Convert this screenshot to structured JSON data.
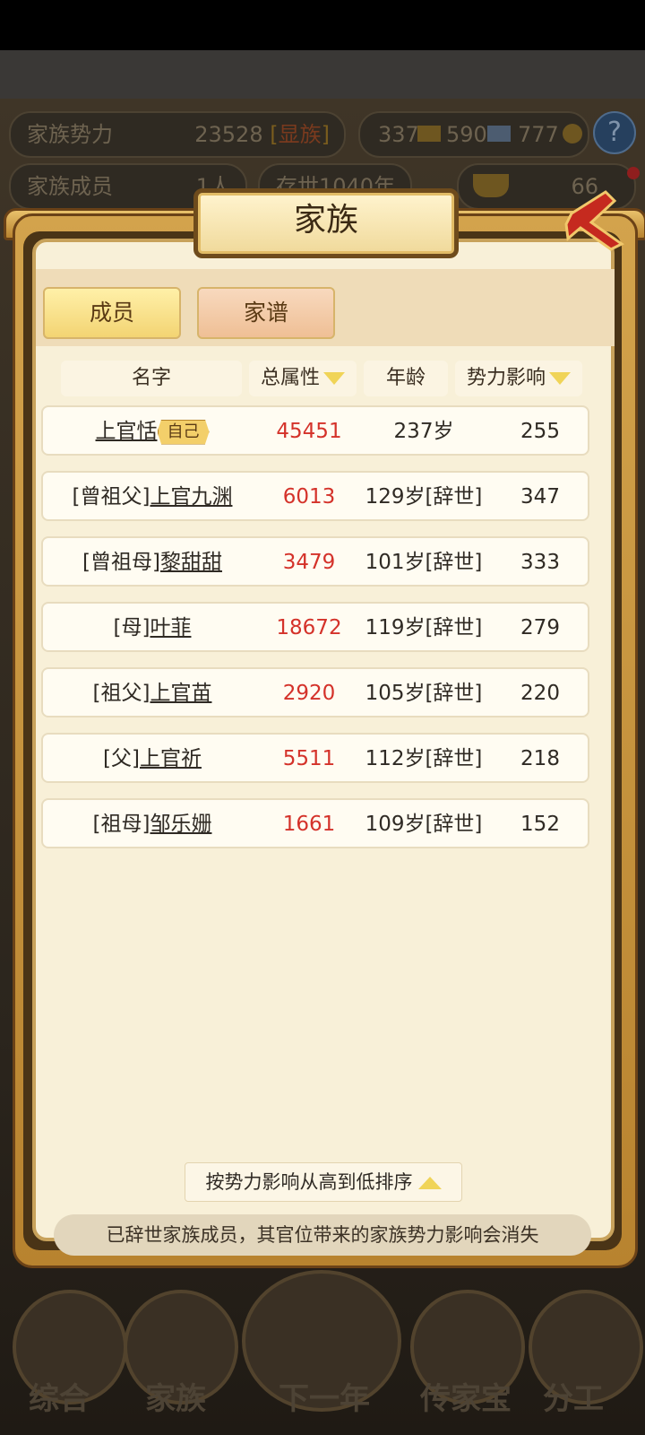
{
  "background_hud": {
    "influence_label": "家族势力",
    "influence_value": "23528",
    "rank_prefix": "[",
    "rank_tag": "显族",
    "rank_suffix": "]",
    "gold_bars": "337",
    "silver_bars": "590",
    "coins": "777",
    "help_label": "?",
    "members_label": "家族成员",
    "members_value": "1人",
    "existence": "存世1040年",
    "ingots": "66"
  },
  "modal": {
    "title": "家族",
    "tabs": [
      {
        "label": "成员",
        "active": true
      },
      {
        "label": "家谱",
        "active": false
      }
    ],
    "columns": {
      "name": "名字",
      "total_attr": "总属性",
      "age": "年龄",
      "influence": "势力影响"
    },
    "self_badge": "自己",
    "rows": [
      {
        "prefix": "",
        "name": "上官恬",
        "is_self": true,
        "total_attr": "45451",
        "age": "237岁",
        "influence": "255"
      },
      {
        "prefix": "[曾祖父]",
        "name": "上官九渊",
        "is_self": false,
        "total_attr": "6013",
        "age": "129岁[辞世]",
        "influence": "347"
      },
      {
        "prefix": "[曾祖母]",
        "name": "黎甜甜",
        "is_self": false,
        "total_attr": "3479",
        "age": "101岁[辞世]",
        "influence": "333"
      },
      {
        "prefix": "[母]",
        "name": "叶菲",
        "is_self": false,
        "total_attr": "18672",
        "age": "119岁[辞世]",
        "influence": "279"
      },
      {
        "prefix": "[祖父]",
        "name": "上官苗",
        "is_self": false,
        "total_attr": "2920",
        "age": "105岁[辞世]",
        "influence": "220"
      },
      {
        "prefix": "[父]",
        "name": "上官祈",
        "is_self": false,
        "total_attr": "5511",
        "age": "112岁[辞世]",
        "influence": "218"
      },
      {
        "prefix": "[祖母]",
        "name": "邹乐姗",
        "is_self": false,
        "total_attr": "1661",
        "age": "109岁[辞世]",
        "influence": "152"
      }
    ],
    "sort_label": "按势力影响从高到低排序",
    "notice": "已辞世家族成员，其官位带来的家族势力影响会消失"
  },
  "bottom_nav": [
    {
      "label": "综合"
    },
    {
      "label": "家族"
    },
    {
      "label": "下一年"
    },
    {
      "label": "传家宝"
    },
    {
      "label": "分工"
    }
  ],
  "colors": {
    "accent_red": "#d4322a",
    "frame_gold": "#c8a25b",
    "panel_bg": "#f8f0d8",
    "sort_triangle": "#f0d457"
  }
}
